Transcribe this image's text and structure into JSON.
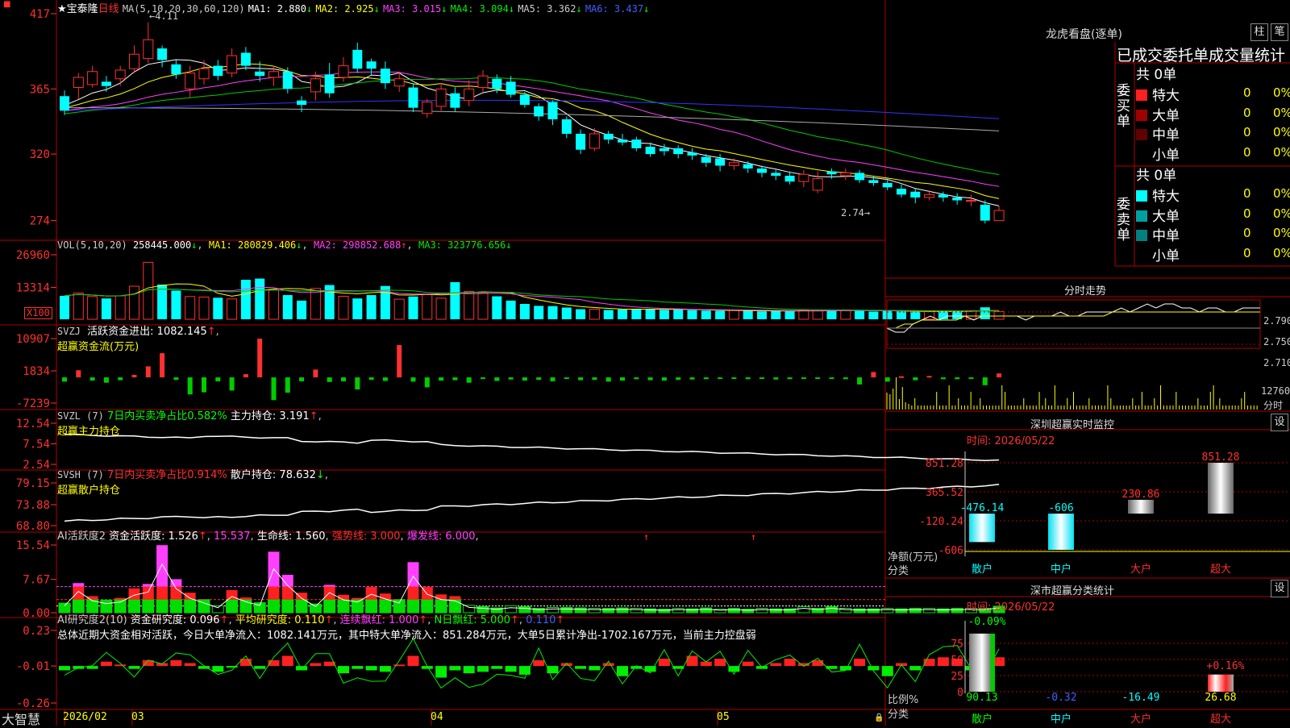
{
  "stock": {
    "star": "★",
    "name": "宝泰隆",
    "period": "日线",
    "high_mark": "4.11",
    "last_mark": "2.74"
  },
  "colors": {
    "up": "#ff3030",
    "down": "#00ffff",
    "ma1": "#ffffff",
    "ma2": "#ffff00",
    "ma3": "#ff40ff",
    "ma4": "#00cc00",
    "ma5": "#aaaaaa",
    "ma6": "#3333ff",
    "grid": "#b00000"
  },
  "candle_data": {
    "type": "candlestick",
    "open": [
      3.6,
      3.66,
      3.68,
      3.7,
      3.72,
      3.79,
      3.86,
      3.93,
      3.82,
      3.65,
      3.72,
      3.81,
      3.76,
      3.9,
      3.77,
      3.73,
      3.77,
      3.57,
      3.63,
      3.75,
      3.73,
      3.92,
      3.84,
      3.79,
      3.67,
      3.66,
      3.48,
      3.53,
      3.62,
      3.57,
      3.66,
      3.72,
      3.7,
      3.61,
      3.53,
      3.56,
      3.44,
      3.34,
      3.24,
      3.34,
      3.3,
      3.3,
      3.25,
      3.24,
      3.24,
      3.21,
      3.18,
      3.17,
      3.12,
      3.13,
      3.1,
      3.07,
      3.05,
      3.01,
      2.95,
      3.08,
      3.05,
      3.07,
      3.02,
      3.0,
      2.96,
      2.94,
      2.9,
      2.92,
      2.9,
      2.88,
      2.85,
      2.74
    ],
    "close": [
      3.5,
      3.73,
      3.77,
      3.67,
      3.78,
      3.89,
      3.99,
      3.85,
      3.75,
      3.76,
      3.79,
      3.74,
      3.88,
      3.81,
      3.74,
      3.77,
      3.65,
      3.54,
      3.72,
      3.62,
      3.81,
      3.79,
      3.79,
      3.69,
      3.72,
      3.52,
      3.56,
      3.65,
      3.52,
      3.65,
      3.74,
      3.65,
      3.61,
      3.54,
      3.46,
      3.44,
      3.34,
      3.23,
      3.34,
      3.3,
      3.28,
      3.24,
      3.2,
      3.22,
      3.2,
      3.19,
      3.14,
      3.12,
      3.14,
      3.1,
      3.07,
      3.05,
      3.01,
      3.06,
      3.03,
      3.06,
      3.07,
      3.02,
      3.0,
      2.97,
      2.92,
      2.9,
      2.92,
      2.9,
      2.88,
      2.88,
      2.74,
      2.81
    ],
    "high": [
      3.64,
      3.76,
      3.81,
      3.74,
      3.81,
      3.95,
      4.11,
      3.95,
      3.85,
      3.81,
      3.85,
      3.85,
      3.93,
      3.94,
      3.84,
      3.81,
      3.8,
      3.6,
      3.77,
      3.83,
      3.87,
      3.97,
      3.86,
      3.84,
      3.77,
      3.69,
      3.58,
      3.69,
      3.66,
      3.71,
      3.78,
      3.75,
      3.74,
      3.63,
      3.55,
      3.57,
      3.46,
      3.37,
      3.38,
      3.36,
      3.34,
      3.32,
      3.28,
      3.27,
      3.26,
      3.24,
      3.2,
      3.2,
      3.17,
      3.15,
      3.12,
      3.09,
      3.08,
      3.09,
      3.08,
      3.1,
      3.1,
      3.09,
      3.05,
      3.03,
      2.99,
      2.96,
      2.95,
      2.94,
      2.93,
      2.92,
      2.88,
      2.84
    ],
    "low": [
      3.47,
      3.58,
      3.66,
      3.63,
      3.67,
      3.76,
      3.83,
      3.8,
      3.72,
      3.59,
      3.68,
      3.71,
      3.73,
      3.78,
      3.7,
      3.67,
      3.62,
      3.49,
      3.57,
      3.59,
      3.7,
      3.76,
      3.74,
      3.65,
      3.63,
      3.49,
      3.45,
      3.5,
      3.49,
      3.53,
      3.63,
      3.62,
      3.59,
      3.52,
      3.43,
      3.4,
      3.31,
      3.2,
      3.22,
      3.27,
      3.26,
      3.22,
      3.18,
      3.19,
      3.17,
      3.16,
      3.11,
      3.08,
      3.09,
      3.07,
      3.04,
      3.02,
      2.99,
      2.97,
      2.93,
      3.03,
      3.02,
      3.0,
      2.98,
      2.95,
      2.9,
      2.86,
      2.88,
      2.87,
      2.85,
      2.84,
      2.72,
      2.74
    ],
    "ylim": [
      2.66,
      4.22
    ],
    "y_ticks": [
      "417",
      "365",
      "320",
      "274"
    ]
  },
  "ma_legend": {
    "label": "MA(5,10,20,30,60,120)",
    "items": [
      {
        "text": "MA1: 2.880",
        "arrow": "↓"
      },
      {
        "text": "MA2: 2.925",
        "arrow": "↓"
      },
      {
        "text": "MA3: 3.015",
        "arrow": "↓"
      },
      {
        "text": "MA4: 3.094",
        "arrow": "↓"
      },
      {
        "text": "MA5: 3.362",
        "arrow": "↓"
      },
      {
        "text": "MA6: 3.437",
        "arrow": "↓"
      }
    ]
  },
  "vol_panel": {
    "label": "VOL(5,10,20)",
    "value": "258445.000",
    "ma1": "MA1: 280829.406",
    "ma2": "MA2: 298852.688",
    "ma3": "MA3: 323776.656",
    "y_ticks": [
      "26960",
      "13314"
    ],
    "unit": "X100",
    "values": [
      9800,
      11000,
      9500,
      8700,
      9800,
      13800,
      23800,
      14500,
      12000,
      9500,
      9300,
      9000,
      8500,
      16500,
      17000,
      12200,
      10100,
      7800,
      12900,
      14300,
      9600,
      8700,
      10100,
      13900,
      8400,
      9500,
      10300,
      8800,
      15500,
      11600,
      11000,
      9600,
      7800,
      6400,
      5600,
      5500,
      4900,
      4200,
      4200,
      3900,
      4100,
      4400,
      4300,
      3900,
      4000,
      3800,
      3600,
      3500,
      3700,
      3600,
      3300,
      3400,
      3300,
      3900,
      3600,
      3800,
      3900,
      3600,
      3200,
      3500,
      3300,
      3100,
      3400,
      3200,
      3100,
      3600,
      5000,
      3200
    ]
  },
  "svzj_panel": {
    "label": "SVZJ",
    "title": "活跃资金进出: 1082.145",
    "arrow": "↑",
    "subtitle": "超赢资金流(万元)",
    "y_ticks": [
      "10907",
      "1834",
      "-7239"
    ],
    "values": [
      -1200,
      2000,
      -900,
      -1500,
      -800,
      700,
      3100,
      6800,
      -700,
      -4800,
      -4200,
      -1100,
      -3700,
      900,
      10900,
      -6400,
      -4300,
      -1100,
      2200,
      -1300,
      -1100,
      -3400,
      -700,
      -1000,
      9100,
      -1200,
      -2800,
      -900,
      -800,
      -1500,
      -400,
      -1000,
      -600,
      -900,
      -700,
      -1100,
      -400,
      -800,
      -700,
      -1200,
      -900,
      -500,
      -800,
      -900,
      -700,
      -600,
      -500,
      -400,
      -300,
      -500,
      -400,
      -600,
      -500,
      -400,
      -300,
      -200,
      -500,
      -2000,
      1500,
      -1200,
      300,
      -800,
      400,
      -500,
      -500,
      -300,
      -2200,
      1100
    ]
  },
  "svzl_panel": {
    "label": "SVZL (7)",
    "desc": "7日内买卖净占比0.582%",
    "holding": "主力持仓: 3.191",
    "arrow": "↑",
    ",": ",",
    "subtitle": "超赢主力持仓",
    "y_ticks": [
      "12.54",
      "7.54",
      "2.54"
    ]
  },
  "svsh_panel": {
    "label": "SVSH (7)",
    "desc": "7日内买卖净占比0.914%",
    "holding": "散户持仓: 78.632",
    "arrow": "↓",
    ",": ",",
    "subtitle": "超赢散户持仓",
    "y_ticks": [
      "79.15",
      "73.88",
      "68.80"
    ]
  },
  "ai_panel": {
    "label": "AI活跃度2",
    "a": "资金活跃度: 1.526",
    "b": "15.537",
    "c": "生命线: 1.560",
    "d": "强势线: 3.000",
    "e": "爆发线: 6.000",
    "y_ticks": [
      "15.54",
      "7.67",
      "0.00"
    ],
    "values": [
      2.2,
      6.8,
      3.8,
      2.9,
      3.4,
      5.6,
      6.6,
      15.5,
      7.7,
      4.6,
      3.1,
      1.6,
      5.2,
      3.5,
      2.3,
      14.0,
      8.7,
      4.6,
      2.0,
      6.4,
      4.1,
      3.4,
      5.9,
      4.4,
      3.1,
      11.6,
      5.9,
      4.2,
      3.8,
      1.7,
      1.4,
      1.1,
      1.6,
      1.4,
      1.0,
      1.2,
      1.2,
      1.1,
      1.0,
      1.0,
      1.1,
      1.0,
      0.9,
      0.8,
      1.0,
      0.9,
      1.1,
      0.8,
      1.0,
      0.8,
      1.0,
      0.9,
      0.9,
      1.4,
      1.0,
      1.4,
      1.0,
      0.9,
      0.9,
      1.0,
      0.9,
      1.0,
      1.0,
      0.9,
      1.0,
      1.0,
      1.0,
      1.5
    ]
  },
  "research_panel": {
    "label": "AI研究度2(10)",
    "a": "资金研究度: 0.096",
    "b": "平均研究度: 0.110",
    "c": "连续飘红: 1.000",
    "d": "N日飘红: 5.000",
    "e": "0.110",
    "summary": "总体近期大资金相对活跃，今日大单净流入：1082.141万元，其中特大单净流入：851.284万元，大单5日累计净出-1702.167万元，当前主力控盘弱",
    "y_ticks": [
      "0.23",
      "-0.01",
      "-0.26"
    ],
    "values": [
      -0.03,
      -0.02,
      -0.02,
      0.03,
      0.01,
      -0.02,
      0.04,
      0.02,
      0.04,
      0.02,
      -0.02,
      -0.04,
      -0.01,
      0.05,
      -0.02,
      0.04,
      0.07,
      -0.03,
      0.02,
      0.03,
      -0.05,
      -0.02,
      -0.03,
      -0.04,
      0.01,
      0.07,
      -0.02,
      -0.08,
      -0.03,
      -0.05,
      -0.04,
      -0.02,
      -0.04,
      -0.06,
      0.04,
      -0.05,
      0.02,
      -0.02,
      -0.03,
      0.02,
      -0.07,
      -0.02,
      -0.04,
      0.05,
      -0.02,
      0.07,
      0.03,
      0.05,
      -0.04,
      0.03,
      -0.02,
      0.02,
      0.05,
      0.02,
      0.04,
      -0.02,
      -0.03,
      0.05,
      -0.03,
      -0.07,
      0.02,
      -0.03,
      0.05,
      0.06,
      0.05,
      -0.03,
      -0.04,
      0.06
    ]
  },
  "x_axis": {
    "app": "大智慧",
    "labels": [
      "2026/02",
      "03",
      "04",
      "05"
    ]
  },
  "dragon_tiger": {
    "title": "龙虎看盘(逐单)",
    "btn1": "柱",
    "btn2": "笔",
    "header": "已成交委托单成交量统计",
    "buy_label": "委买单",
    "sell_label": "委卖单",
    "buy_total": "共 0单",
    "sell_total": "共 0单",
    "buy_rows": [
      {
        "label": "特大",
        "count": "0",
        "pct": "0%",
        "color": "#ff2020"
      },
      {
        "label": "大单",
        "count": "0",
        "pct": "0%",
        "color": "#a00000"
      },
      {
        "label": "中单",
        "count": "0",
        "pct": "0%",
        "color": "#600000"
      },
      {
        "label": "小单",
        "count": "0",
        "pct": "0%",
        "color": "#000000"
      }
    ],
    "sell_rows": [
      {
        "label": "特大",
        "count": "0",
        "pct": "0%",
        "color": "#00ffff"
      },
      {
        "label": "大单",
        "count": "0",
        "pct": "0%",
        "color": "#00a0a0"
      },
      {
        "label": "中单",
        "count": "0",
        "pct": "0%",
        "color": "#008080"
      },
      {
        "label": "小单",
        "count": "0",
        "pct": "0%",
        "color": "#000000"
      }
    ]
  },
  "intraday": {
    "title": "分时走势",
    "y_ticks": [
      "2.790",
      "2.750",
      "2.710",
      "12760"
    ],
    "last_label": "分时",
    "price": [
      2.75,
      2.74,
      2.74,
      2.76,
      2.77,
      2.78,
      2.77,
      2.78,
      2.78,
      2.78,
      2.77,
      2.78,
      2.78,
      2.78,
      2.78,
      2.78,
      2.77,
      2.78,
      2.78,
      2.78,
      2.79,
      2.78,
      2.78,
      2.79,
      2.79,
      2.79,
      2.79,
      2.8,
      2.79,
      2.8,
      2.81,
      2.8,
      2.81,
      2.81,
      2.8,
      2.8,
      2.79,
      2.8,
      2.8,
      2.79,
      2.79,
      2.8,
      2.8,
      2.8
    ],
    "avg": [
      2.75,
      2.75,
      2.76,
      2.76,
      2.77,
      2.77,
      2.77,
      2.77,
      2.77,
      2.78,
      2.78,
      2.78,
      2.78,
      2.78,
      2.78,
      2.78,
      2.78,
      2.78,
      2.78,
      2.78,
      2.78,
      2.78,
      2.78,
      2.78,
      2.78,
      2.78,
      2.79,
      2.79,
      2.79,
      2.79,
      2.79,
      2.79,
      2.79,
      2.79,
      2.79,
      2.79,
      2.79,
      2.79,
      2.79,
      2.79,
      2.79,
      2.79,
      2.79,
      2.79
    ],
    "ylim": [
      2.7,
      2.82
    ]
  },
  "sz_monitor": {
    "title": "深圳超赢实时监控",
    "btn": "设",
    "time": "时间: 2026/05/22",
    "y_ticks": [
      "851.28",
      "365.52",
      "-120.24",
      "-606"
    ],
    "ylabel": "净额(万元)",
    "xlabel": "分类",
    "categories": [
      "散户",
      "中户",
      "大户",
      "超大"
    ],
    "values": [
      -476.14,
      -606,
      230.86,
      851.28
    ],
    "value_labels": [
      "-476.14",
      "-606",
      "230.86",
      "851.28"
    ]
  },
  "sz_class": {
    "title": "深市超赢分类统计",
    "btn": "设",
    "time": "时间: 2026/05/22",
    "y_ticks": [
      "75",
      "50",
      "25",
      "0"
    ],
    "ylabel": "比例%",
    "xlabel": "分类",
    "categories": [
      "散户",
      "中户",
      "大户",
      "超大"
    ],
    "values": [
      90.13,
      -0.32,
      -16.49,
      26.68
    ],
    "value_labels": [
      "90.13",
      "-0.32",
      "-16.49",
      "26.68"
    ],
    "top_labels": [
      "-0.09%",
      "+0.16%"
    ]
  }
}
